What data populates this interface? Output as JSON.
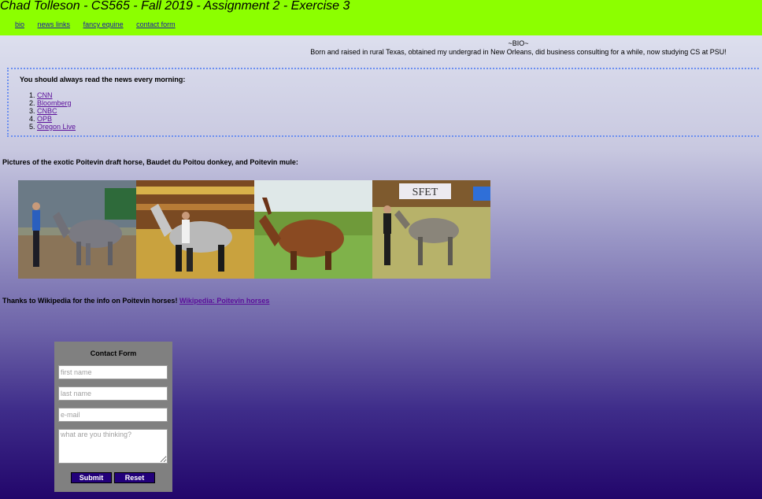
{
  "header": {
    "title": "Chad Tolleson - CS565 - Fall 2019 - Assignment 2 - Exercise 3",
    "nav": [
      "bio",
      "news links",
      "fancy equine",
      "contact form"
    ]
  },
  "bio": {
    "heading": "~BIO~",
    "text": "Born and raised in rural Texas, obtained my undergrad in New Orleans, did business consulting for a while, now studying CS at PSU!"
  },
  "news": {
    "heading": "You should always read the news every morning:",
    "links": [
      "CNN",
      "Bloomberg",
      "CNBC",
      "OPB",
      "Oregon Live"
    ]
  },
  "gallery": {
    "caption": "Pictures of the exotic Poitevin draft horse, Baudet du Poitou donkey, and Poitevin mule:",
    "sign_text": "SFET"
  },
  "credits": {
    "text": "Thanks to Wikipedia for the info on Poitevin horses!",
    "link": "Wikipedia: Poitevin horses"
  },
  "contact_form": {
    "title": "Contact Form",
    "first_name_placeholder": "first name",
    "last_name_placeholder": "last name",
    "email_placeholder": "e-mail",
    "message_placeholder": "what are you thinking?",
    "submit_label": "Submit",
    "reset_label": "Reset"
  },
  "colors": {
    "header_bg": "#8cff00",
    "link": "#5b0f9a",
    "nav_link": "#1d1aa8",
    "news_border": "#6c8ff0",
    "form_bg": "#808080",
    "button_bg": "#22007a"
  }
}
